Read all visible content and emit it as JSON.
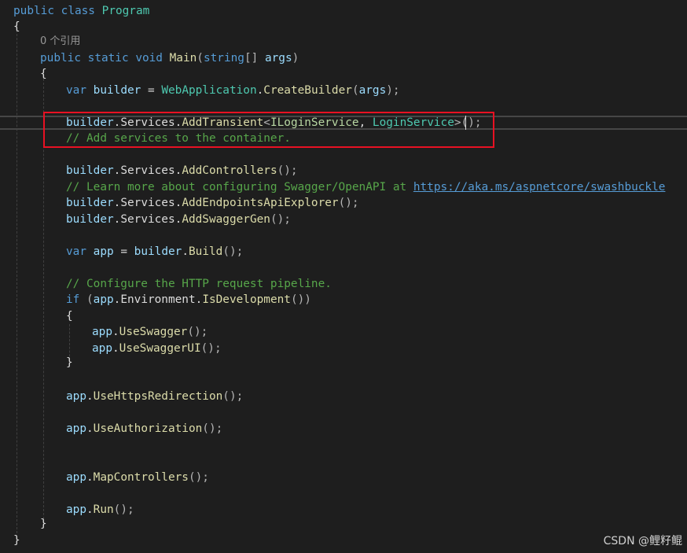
{
  "editor": {
    "lines": {
      "l1": {
        "kw1": "public",
        "kw2": "class",
        "name": "Program"
      },
      "l2": {
        "brace": "{"
      },
      "l3": {
        "refs": "0 个引用"
      },
      "l4": {
        "kw1": "public",
        "kw2": "static",
        "kw3": "void",
        "name": "Main",
        "open": "(",
        "type": "string",
        "arr": "[]",
        "param": "args",
        "close": ")"
      },
      "l5": {
        "brace": "{"
      },
      "l6": {
        "kw": "var",
        "var": "builder",
        "eq": " = ",
        "type": "WebApplication",
        "dot": ".",
        "method": "CreateBuilder",
        "open": "(",
        "arg": "args",
        "close": ");"
      },
      "l7": {
        "obj": "builder",
        "dot1": ".",
        "prop": "Services",
        "dot2": ".",
        "method": "AddTransient",
        "lt": "<",
        "iface": "ILoginService",
        "comma": ", ",
        "type": "LoginService",
        "gt": ">",
        "call": "();"
      },
      "l8": {
        "comment": "// Add services to the container."
      },
      "l9": {
        "obj": "builder",
        "dot1": ".",
        "prop": "Services",
        "dot2": ".",
        "method": "AddControllers",
        "call": "();"
      },
      "l10": {
        "comment": "// Learn more about configuring Swagger/OpenAPI at ",
        "link": "https://aka.ms/aspnetcore/swashbuckle"
      },
      "l11": {
        "obj": "builder",
        "dot1": ".",
        "prop": "Services",
        "dot2": ".",
        "method": "AddEndpointsApiExplorer",
        "call": "();"
      },
      "l12": {
        "obj": "builder",
        "dot1": ".",
        "prop": "Services",
        "dot2": ".",
        "method": "AddSwaggerGen",
        "call": "();"
      },
      "l13": {
        "kw": "var",
        "var": "app",
        "eq": " = ",
        "obj": "builder",
        "dot": ".",
        "method": "Build",
        "call": "();"
      },
      "l14": {
        "comment": "// Configure the HTTP request pipeline."
      },
      "l15": {
        "kw": "if",
        "open": " (",
        "obj": "app",
        "dot1": ".",
        "prop": "Environment",
        "dot2": ".",
        "method": "IsDevelopment",
        "call": "())"
      },
      "l16": {
        "brace": "{"
      },
      "l17": {
        "obj": "app",
        "dot": ".",
        "method": "UseSwagger",
        "call": "();"
      },
      "l18": {
        "obj": "app",
        "dot": ".",
        "method": "UseSwaggerUI",
        "call": "();"
      },
      "l19": {
        "brace": "}"
      },
      "l20": {
        "obj": "app",
        "dot": ".",
        "method": "UseHttpsRedirection",
        "call": "();"
      },
      "l21": {
        "obj": "app",
        "dot": ".",
        "method": "UseAuthorization",
        "call": "();"
      },
      "l22": {
        "obj": "app",
        "dot": ".",
        "method": "MapControllers",
        "call": "();"
      },
      "l23": {
        "obj": "app",
        "dot": ".",
        "method": "Run",
        "call": "();"
      },
      "l24": {
        "brace": "}"
      },
      "l25": {
        "brace": "}"
      }
    }
  },
  "watermark": {
    "text": "CSDN @鲤籽鲲"
  },
  "colors": {
    "background": "#1e1e1e",
    "keyword": "#569cd6",
    "type": "#4ec9b0",
    "interface": "#b8d7a3",
    "method": "#dcdcaa",
    "parameter": "#9cdcfe",
    "comment": "#57a64a",
    "highlight_box": "#e81123"
  }
}
